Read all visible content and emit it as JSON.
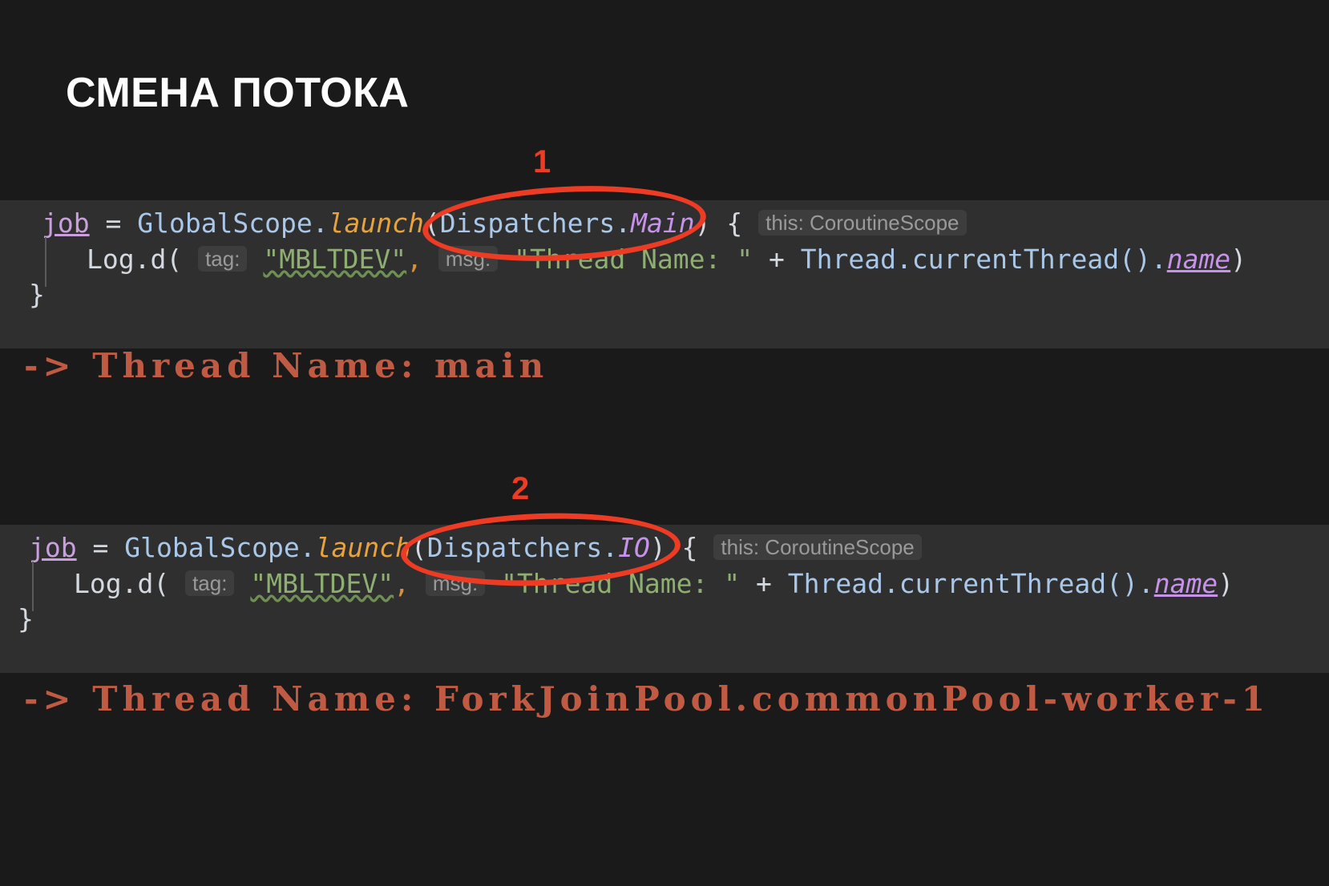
{
  "slide": {
    "title": "СМЕНА ПОТОКА",
    "background_color": "#1a1a1a",
    "code_background_color": "#2f2f2f"
  },
  "annotations": [
    {
      "number": "1",
      "shape": "ellipse",
      "color": "#ee3b24",
      "targets": "Dispatchers.Main"
    },
    {
      "number": "2",
      "shape": "ellipse",
      "color": "#ee3b24",
      "targets": "Dispatchers.IO"
    }
  ],
  "code_blocks": [
    {
      "id": "block-1",
      "dispatcher": "Main",
      "line1": {
        "var": "job",
        "eq": " = ",
        "scope": "GlobalScope.",
        "fn": "launch",
        "open": "(",
        "class": "Dispatchers.",
        "prop": "Main",
        "close": ")",
        "brace": " { ",
        "inlay": "this: CoroutineScope"
      },
      "line2": {
        "call": "Log.d( ",
        "inlay_tag": "tag:",
        "tag_value": "\"MBLTDEV\"",
        "comma": ",",
        "inlay_msg": "msg:",
        "msg_value": "\"Thread Name: \"",
        "plus": " + ",
        "expr": "Thread.currentThread().",
        "prop": "name",
        "close": ")"
      },
      "line3": {
        "brace": "}"
      }
    },
    {
      "id": "block-2",
      "dispatcher": "IO",
      "line1": {
        "var": "job",
        "eq": " = ",
        "scope": "GlobalScope.",
        "fn": "launch",
        "open": "(",
        "class": "Dispatchers.",
        "prop": "IO",
        "close": ")",
        "brace": " { ",
        "inlay": "this: CoroutineScope"
      },
      "line2": {
        "call": "Log.d( ",
        "inlay_tag": "tag:",
        "tag_value": "\"MBLTDEV\"",
        "comma": ",",
        "inlay_msg": "msg:",
        "msg_value": "\"Thread Name: \"",
        "plus": " + ",
        "expr": "Thread.currentThread().",
        "prop": "name",
        "close": ")"
      },
      "line3": {
        "brace": "}"
      }
    }
  ],
  "outputs": [
    {
      "text": "-> Thread Name: main",
      "color": "#c05a42"
    },
    {
      "text": "-> Thread Name: ForkJoinPool.commonPool-worker-1",
      "color": "#c05a42"
    }
  ]
}
